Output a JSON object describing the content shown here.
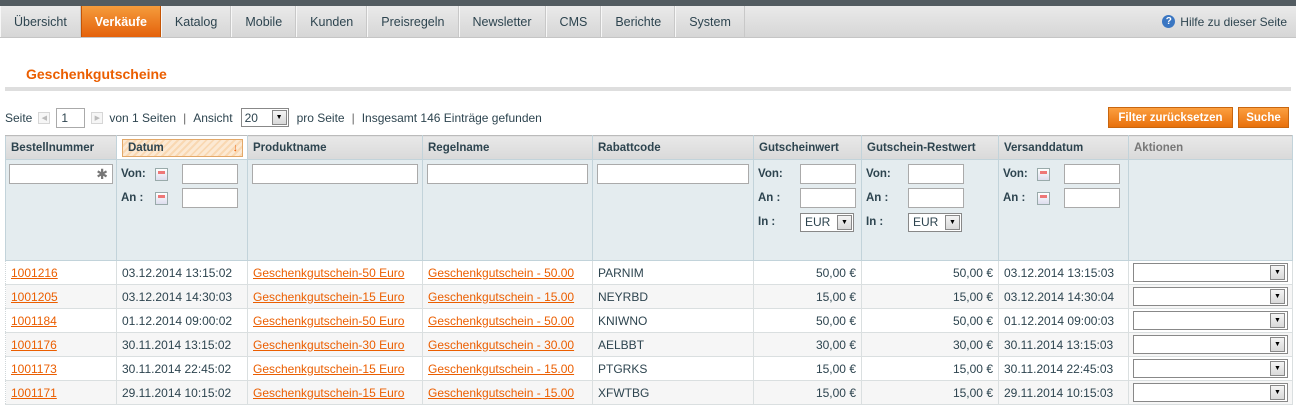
{
  "nav": {
    "items": [
      "Übersicht",
      "Verkäufe",
      "Katalog",
      "Mobile",
      "Kunden",
      "Preisregeln",
      "Newsletter",
      "CMS",
      "Berichte",
      "System"
    ],
    "active": "Verkäufe",
    "help_label": "Hilfe zu dieser Seite"
  },
  "page_title": "Geschenkgutscheine",
  "pager": {
    "page_label": "Seite",
    "page_value": "1",
    "of_label": "von 1 Seiten",
    "view_label": "Ansicht",
    "per_page": "20",
    "per_page_label": "pro Seite",
    "total_label": "Insgesamt 146 Einträge gefunden",
    "separator": "|"
  },
  "buttons": {
    "reset_filter": "Filter zurücksetzen",
    "search": "Suche"
  },
  "columns": [
    "Bestellnummer",
    "Datum",
    "Produktname",
    "Regelname",
    "Rabattcode",
    "Gutscheinwert",
    "Gutschein-Restwert",
    "Versanddatum",
    "Aktionen"
  ],
  "filters": {
    "from_label": "Von:",
    "to_label": "An :",
    "in_label": "In :",
    "currency": "EUR"
  },
  "rows": [
    {
      "order": "1001216",
      "date": "03.12.2014 13:15:02",
      "product": "Geschenkgutschein-50 Euro",
      "rule": "Geschenkgutschein - 50.00",
      "code": "PARNIM",
      "value": "50,00 €",
      "rest": "50,00 €",
      "ship": "03.12.2014 13:15:03"
    },
    {
      "order": "1001205",
      "date": "03.12.2014 14:30:03",
      "product": "Geschenkgutschein-15 Euro",
      "rule": "Geschenkgutschein - 15.00",
      "code": "NEYRBD",
      "value": "15,00 €",
      "rest": "15,00 €",
      "ship": "03.12.2014 14:30:04"
    },
    {
      "order": "1001184",
      "date": "01.12.2014 09:00:02",
      "product": "Geschenkgutschein-50 Euro",
      "rule": "Geschenkgutschein - 50.00",
      "code": "KNIWNO",
      "value": "50,00 €",
      "rest": "50,00 €",
      "ship": "01.12.2014 09:00:03"
    },
    {
      "order": "1001176",
      "date": "30.11.2014 13:15:02",
      "product": "Geschenkgutschein-30 Euro",
      "rule": "Geschenkgutschein - 30.00",
      "code": "AELBBT",
      "value": "30,00 €",
      "rest": "30,00 €",
      "ship": "30.11.2014 13:15:03"
    },
    {
      "order": "1001173",
      "date": "30.11.2014 22:45:02",
      "product": "Geschenkgutschein-15 Euro",
      "rule": "Geschenkgutschein - 15.00",
      "code": "PTGRKS",
      "value": "15,00 €",
      "rest": "15,00 €",
      "ship": "30.11.2014 22:45:03"
    },
    {
      "order": "1001171",
      "date": "29.11.2014 10:15:02",
      "product": "Geschenkgutschein-15 Euro",
      "rule": "Geschenkgutschein - 15.00",
      "code": "XFWTBG",
      "value": "15,00 €",
      "rest": "15,00 €",
      "ship": "29.11.2014 10:15:03"
    }
  ]
}
